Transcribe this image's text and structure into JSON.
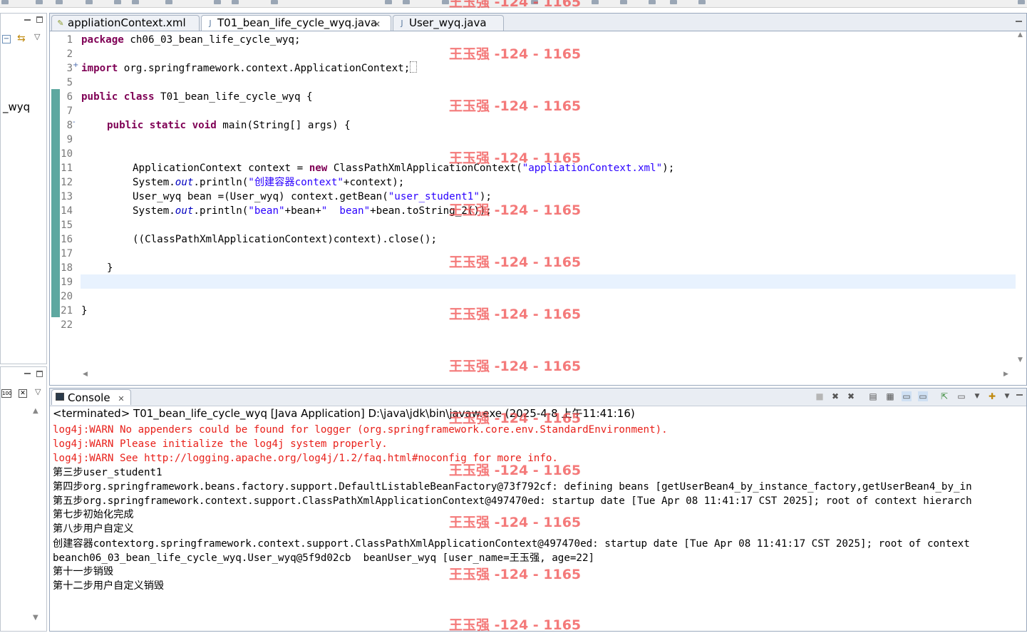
{
  "left_panel": {
    "top_label": "_wyq"
  },
  "editor": {
    "tabs": [
      {
        "label": "appliationContext.xml",
        "icon": "xml-file-icon"
      },
      {
        "label": "T01_bean_life_cycle_wyq.java",
        "icon": "java-file-icon",
        "active": true
      },
      {
        "label": "User_wyq.java",
        "icon": "java-file-icon"
      }
    ],
    "line_numbers": [
      "1",
      "2",
      "3",
      "5",
      "6",
      "7",
      "8",
      "9",
      "10",
      "11",
      "12",
      "13",
      "14",
      "15",
      "16",
      "17",
      "18",
      "19",
      "20",
      "21",
      "22"
    ],
    "fold_markers": {
      "line3": "+",
      "line8": "-"
    },
    "code": {
      "l1_kw": "package",
      "l1_rest": " ch06_03_bean_life_cycle_wyq;",
      "l3_kw": "import",
      "l3_rest": " org.springframework.context.ApplicationContext;",
      "l6_kw1": "public",
      "l6_kw2": "class",
      "l6_rest": " T01_bean_life_cycle_wyq {",
      "l8_kw1": "public",
      "l8_kw2": "static",
      "l8_kw3": "void",
      "l8_rest": " main(String[] args) {",
      "l11_a": "ApplicationContext context = ",
      "l11_kw": "new",
      "l11_b": " ClassPathXmlApplicationContext(",
      "l11_str": "\"appliationContext.xml\"",
      "l11_c": ");",
      "l12_a": "System.",
      "l12_fld": "out",
      "l12_b": ".println(",
      "l12_str": "\"创建容器context\"",
      "l12_c": "+context);",
      "l13_a": "User_wyq bean =(User_wyq) context.getBean(",
      "l13_str": "\"user_student1\"",
      "l13_c": ");",
      "l14_a": "System.",
      "l14_fld": "out",
      "l14_b": ".println(",
      "l14_str1": "\"bean\"",
      "l14_c": "+bean+",
      "l14_str2": "\"  bean\"",
      "l14_d": "+bean.toString_2());",
      "l16": "((ClassPathXmlApplicationContext)context).close();",
      "l18": "}",
      "l21": "}"
    }
  },
  "console": {
    "tab_label": "Console",
    "status": "<terminated> T01_bean_life_cycle_wyq [Java Application] D:\\java\\jdk\\bin\\javaw.exe (2025-4-8 上午11:41:16)",
    "lines": [
      {
        "text": "log4j:WARN No appenders could be found for logger (org.springframework.core.env.StandardEnvironment).",
        "err": true
      },
      {
        "text": "log4j:WARN Please initialize the log4j system properly.",
        "err": true
      },
      {
        "text": "log4j:WARN See http://logging.apache.org/log4j/1.2/faq.html#noconfig for more info.",
        "err": true
      },
      {
        "text": "第三步user_student1"
      },
      {
        "text": "第四步org.springframework.beans.factory.support.DefaultListableBeanFactory@73f792cf: defining beans [getUserBean4_by_instance_factory,getUserBean4_by_in"
      },
      {
        "text": "第五步org.springframework.context.support.ClassPathXmlApplicationContext@497470ed: startup date [Tue Apr 08 11:41:17 CST 2025]; root of context hierarch"
      },
      {
        "text": "第七步初始化完成"
      },
      {
        "text": "第八步用户自定义"
      },
      {
        "text": "创建容器contextorg.springframework.context.support.ClassPathXmlApplicationContext@497470ed: startup date [Tue Apr 08 11:41:17 CST 2025]; root of context"
      },
      {
        "text": "beanch06_03_bean_life_cycle_wyq.User_wyq@5f9d02cb  beanUser_wyq [user_name=王玉强, age=22]"
      },
      {
        "text": "第十一步销毁"
      },
      {
        "text": "第十二步用户自定义销毁"
      }
    ]
  },
  "watermark": {
    "text": "王玉强 -124 - 1165"
  },
  "colors": {
    "keyword": "#7f0055",
    "string": "#2a00ff",
    "field": "#0000c0",
    "error": "#e8201a",
    "watermark": "#f04646",
    "current_line": "#e8f2fe"
  }
}
